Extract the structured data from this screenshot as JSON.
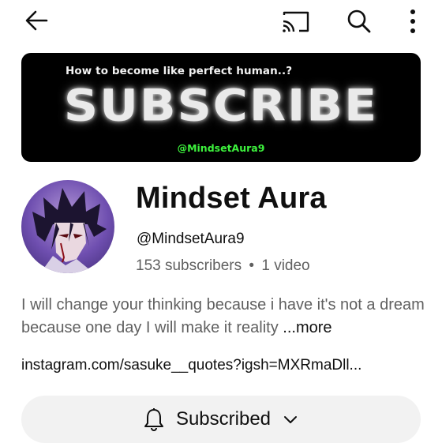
{
  "topbar": {
    "back_icon": "arrow-left-icon",
    "cast_icon": "cast-icon",
    "search_icon": "search-icon",
    "menu_icon": "more-vertical-icon"
  },
  "banner": {
    "tagline": "How to become like perfect human..?",
    "headline": "SUBSCRIBE",
    "handle": "@MindsetAura9"
  },
  "channel": {
    "name": "Mindset Aura",
    "handle": "@MindsetAura9",
    "subscribers": "153 subscribers",
    "separator": "•",
    "videos": "1 video",
    "description": "I will change your thinking because  i have it's not a dream because one day I will make it reality",
    "more_label": "...more",
    "link": "instagram.com/sasuke__quotes?igsh=MXRmaDll..."
  },
  "subscribe_button": {
    "label": "Subscribed",
    "bell_icon": "bell-icon",
    "chevron_icon": "chevron-down-icon"
  }
}
